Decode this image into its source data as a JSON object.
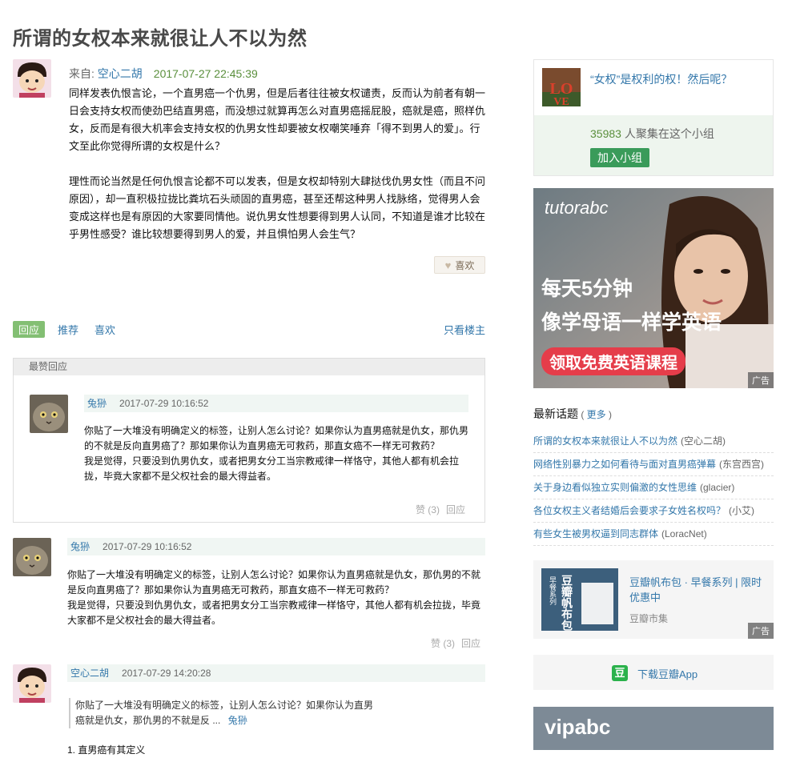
{
  "page_title": "所谓的女权本来就很让人不以为然",
  "post": {
    "from_label": "来自: ",
    "author": "空心二胡",
    "time": "2017-07-27 22:45:39",
    "body": "同样发表仇恨言论，一个直男癌一个仇男，但是后者往往被女权谴责，反而认为前者有朝一日会支持女权而使劲巴结直男癌，而没想过就算再怎么对直男癌摇屁股，癌就是癌，照样仇女，反而是有很大机率会支持女权的仇男女性却要被女权嘲笑唾弃「得不到男人的爱」。行文至此你觉得所谓的女权是什么？\n\n理性而论当然是任何仇恨言论都不可以发表，但是女权却特别大肆挞伐仇男女性（而且不问原因），却一直积极拉拢比粪坑石头顽固的直男癌，甚至还帮这种男人找脉络，觉得男人会变成这样也是有原因的大家要同情他。说仇男女性想要得到男人认同，不知道是谁才比较在乎男性感受？谁比较想要得到男人的爱，并且惧怕男人会生气？",
    "like_label": "喜欢"
  },
  "actions": {
    "reply": "回应",
    "recommend": "推荐",
    "like": "喜欢",
    "only_op": "只看楼主"
  },
  "best_replies": {
    "header": "最赞回应",
    "item": {
      "user": "兔狲",
      "time": "2017-07-29 10:16:52",
      "text": "你贴了一大堆没有明确定义的标签，让别人怎么讨论？如果你认为直男癌就是仇女，那仇男的不就是反向直男癌了？那如果你认为直男癌无可救药，那直女癌不一样无可救药？\n我是觉得，只要没到仇男仇女，或者把男女分工当宗教戒律一样恪守，其他人都有机会拉拢，毕竟大家都不是父权社会的最大得益者。",
      "vote": "赞 (3)",
      "reply": "回应"
    }
  },
  "replies": [
    {
      "user": "兔狲",
      "time": "2017-07-29 10:16:52",
      "text": "你贴了一大堆没有明确定义的标签，让别人怎么讨论？如果你认为直男癌就是仇女，那仇男的不就是反向直男癌了？那如果你认为直男癌无可救药，那直女癌不一样无可救药？\n我是觉得，只要没到仇男仇女，或者把男女分工当宗教戒律一样恪守，其他人都有机会拉拢，毕竟大家都不是父权社会的最大得益者。",
      "vote": "赞 (3)",
      "reply": "回应"
    },
    {
      "user": "空心二胡",
      "time": "2017-07-29 14:20:28",
      "quote": "你贴了一大堆没有明确定义的标签，让别人怎么讨论？如果你认为直男癌就是仇女，那仇男的不就是反 ...",
      "quote_author": "兔狲",
      "text": "1. 直男癌有其定义"
    }
  ],
  "sidebar": {
    "group_title": "“女权”是权利的权！然后呢？",
    "members_count": "35983",
    "members_suffix": " 人聚集在这个小组",
    "join_label": "加入小组",
    "ad1": {
      "brand": "tutorabc",
      "line1": "每天5分钟",
      "line2": "像学母语一样学英语",
      "cta": "领取免费英语课程",
      "tag": "广告"
    },
    "latest_header": "最新话题",
    "more_label": "更多",
    "topics": [
      {
        "title": "所谓的女权本来就很让人不以为然",
        "author": "(空心二胡)"
      },
      {
        "title": "网络性别暴力之如何看待与面对直男癌弹幕",
        "author": "(东宫西宫)"
      },
      {
        "title": "关于身边看似独立实则偏激的女性思维",
        "author": "(glacier)"
      },
      {
        "title": "各位女权主义者结婚后会要求子女姓名权吗？",
        "author": "(小艾)"
      },
      {
        "title": "有些女生被男权逼到同志群体",
        "author": "(LoracNet)"
      }
    ],
    "market": {
      "title": "豆瓣帆布包 · 早餐系列 | 限时优惠中",
      "source": "豆瓣市集",
      "img_text": "豆瓣帆布包",
      "img_sub": "早餐系列",
      "tag": "广告"
    },
    "app_label": "下载豆瓣App",
    "app_icon": "豆",
    "ad2_brand": "vipabc"
  },
  "colors": {
    "link": "#3377aa",
    "green": "#5a8f3c",
    "reply_meta_bg": "#f0f6f3"
  }
}
